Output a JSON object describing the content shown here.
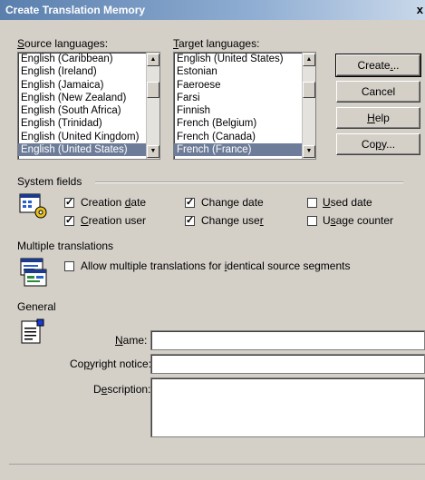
{
  "window": {
    "title": "Create Translation Memory",
    "close_label": "x"
  },
  "source": {
    "label_u": "S",
    "label_rest": "ource languages:",
    "items": [
      "English (Caribbean)",
      "English (Ireland)",
      "English (Jamaica)",
      "English (New Zealand)",
      "English (South Africa)",
      "English (Trinidad)",
      "English (United Kingdom)",
      "English (United States)"
    ],
    "selected_index": 7
  },
  "target": {
    "label_u": "T",
    "label_rest": "arget languages:",
    "items": [
      "English (United States)",
      "Estonian",
      "Faeroese",
      "Farsi",
      "Finnish",
      "French (Belgium)",
      "French (Canada)",
      "French (France)"
    ],
    "selected_index": 7
  },
  "buttons": {
    "create_a": "Create",
    "create_u": ".",
    "create_b": "..",
    "cancel": "Cancel",
    "help_u": "H",
    "help_rest": "elp",
    "copy_a": "Co",
    "copy_u": "p",
    "copy_b": "y..."
  },
  "system_fields": {
    "heading": "System fields",
    "creation_date": {
      "a": "Creation ",
      "u": "d",
      "b": "ate",
      "checked": true
    },
    "creation_user": {
      "a": "",
      "u": "C",
      "b": "reation user",
      "checked": true
    },
    "change_date": {
      "a": "Change date",
      "u": "",
      "b": "",
      "checked": true
    },
    "change_user": {
      "a": "Change use",
      "u": "r",
      "b": "",
      "checked": true
    },
    "used_date": {
      "a": "",
      "u": "U",
      "b": "sed date",
      "checked": false
    },
    "usage_counter": {
      "a": "U",
      "u": "s",
      "b": "age counter",
      "checked": false
    }
  },
  "multiple_translations": {
    "heading": "Multiple translations",
    "allow_a": "Allow multiple translations for ",
    "allow_u": "i",
    "allow_b": "dentical source segments",
    "checked": false
  },
  "general": {
    "heading": "General",
    "name_u": "N",
    "name_rest": "ame:",
    "name_value": "",
    "copyright_a": "Co",
    "copyright_u": "p",
    "copyright_b": "yright notice:",
    "copyright_value": "",
    "description_a": "D",
    "description_u": "e",
    "description_b": "scription:",
    "description_value": ""
  },
  "colors": {
    "title_start": "#5a7fad",
    "selection": "#6d7d99",
    "face": "#d4d0c8"
  }
}
